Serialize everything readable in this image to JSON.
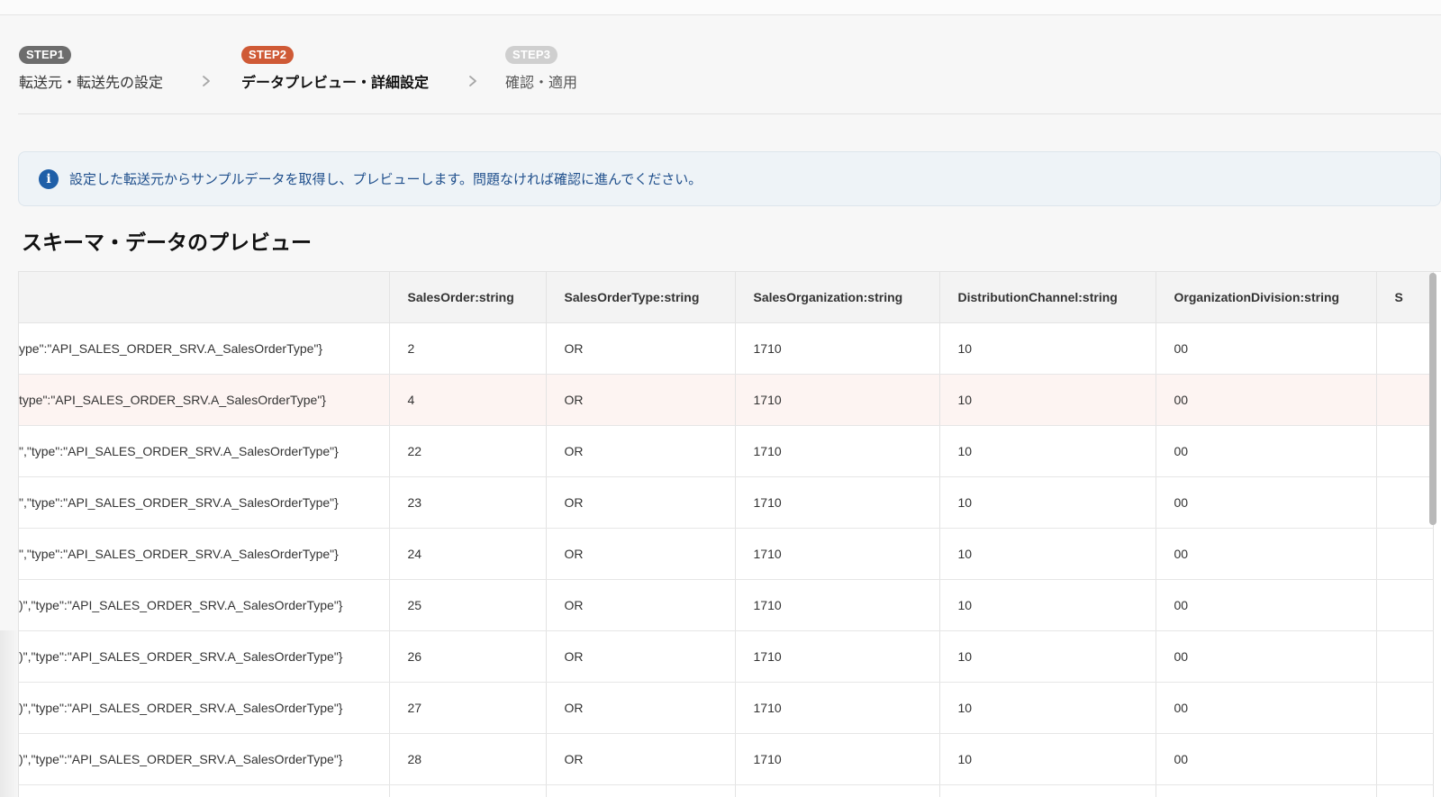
{
  "stepper": {
    "steps": [
      {
        "badge": "STEP1",
        "label": "転送元・転送先の設定"
      },
      {
        "badge": "STEP2",
        "label": "データプレビュー・詳細設定"
      },
      {
        "badge": "STEP3",
        "label": "確認・適用"
      }
    ],
    "active_step": 2
  },
  "info_banner": {
    "icon": "info-icon",
    "text": "設定した転送元からサンプルデータを取得し、プレビューします。問題なければ確認に進んでください。"
  },
  "section_title": "スキーマ・データのプレビュー",
  "table": {
    "columns": [
      "",
      "SalesOrder:string",
      "SalesOrderType:string",
      "SalesOrganization:string",
      "DistributionChannel:string",
      "OrganizationDivision:string",
      "S"
    ],
    "rows": [
      [
        "ype\":\"API_SALES_ORDER_SRV.A_SalesOrderType\"}",
        "2",
        "OR",
        "1710",
        "10",
        "00",
        ""
      ],
      [
        "type\":\"API_SALES_ORDER_SRV.A_SalesOrderType\"}",
        "4",
        "OR",
        "1710",
        "10",
        "00",
        ""
      ],
      [
        "\",\"type\":\"API_SALES_ORDER_SRV.A_SalesOrderType\"}",
        "22",
        "OR",
        "1710",
        "10",
        "00",
        ""
      ],
      [
        "\",\"type\":\"API_SALES_ORDER_SRV.A_SalesOrderType\"}",
        "23",
        "OR",
        "1710",
        "10",
        "00",
        ""
      ],
      [
        "\",\"type\":\"API_SALES_ORDER_SRV.A_SalesOrderType\"}",
        "24",
        "OR",
        "1710",
        "10",
        "00",
        ""
      ],
      [
        ")\",\"type\":\"API_SALES_ORDER_SRV.A_SalesOrderType\"}",
        "25",
        "OR",
        "1710",
        "10",
        "00",
        ""
      ],
      [
        ")\",\"type\":\"API_SALES_ORDER_SRV.A_SalesOrderType\"}",
        "26",
        "OR",
        "1710",
        "10",
        "00",
        ""
      ],
      [
        ")\",\"type\":\"API_SALES_ORDER_SRV.A_SalesOrderType\"}",
        "27",
        "OR",
        "1710",
        "10",
        "00",
        ""
      ],
      [
        ")\",\"type\":\"API_SALES_ORDER_SRV.A_SalesOrderType\"}",
        "28",
        "OR",
        "1710",
        "10",
        "00",
        ""
      ],
      [
        "",
        "",
        "",
        "",
        "",
        "",
        ""
      ]
    ],
    "highlighted_row": 1
  },
  "colors": {
    "step_active": "#cf5a36",
    "step_done": "#6d6d6d",
    "step_pending": "#cfcfcf",
    "info_bg": "#eef3f7",
    "info_text": "#1f4f8c",
    "row_highlight": "#fdf4f2"
  }
}
